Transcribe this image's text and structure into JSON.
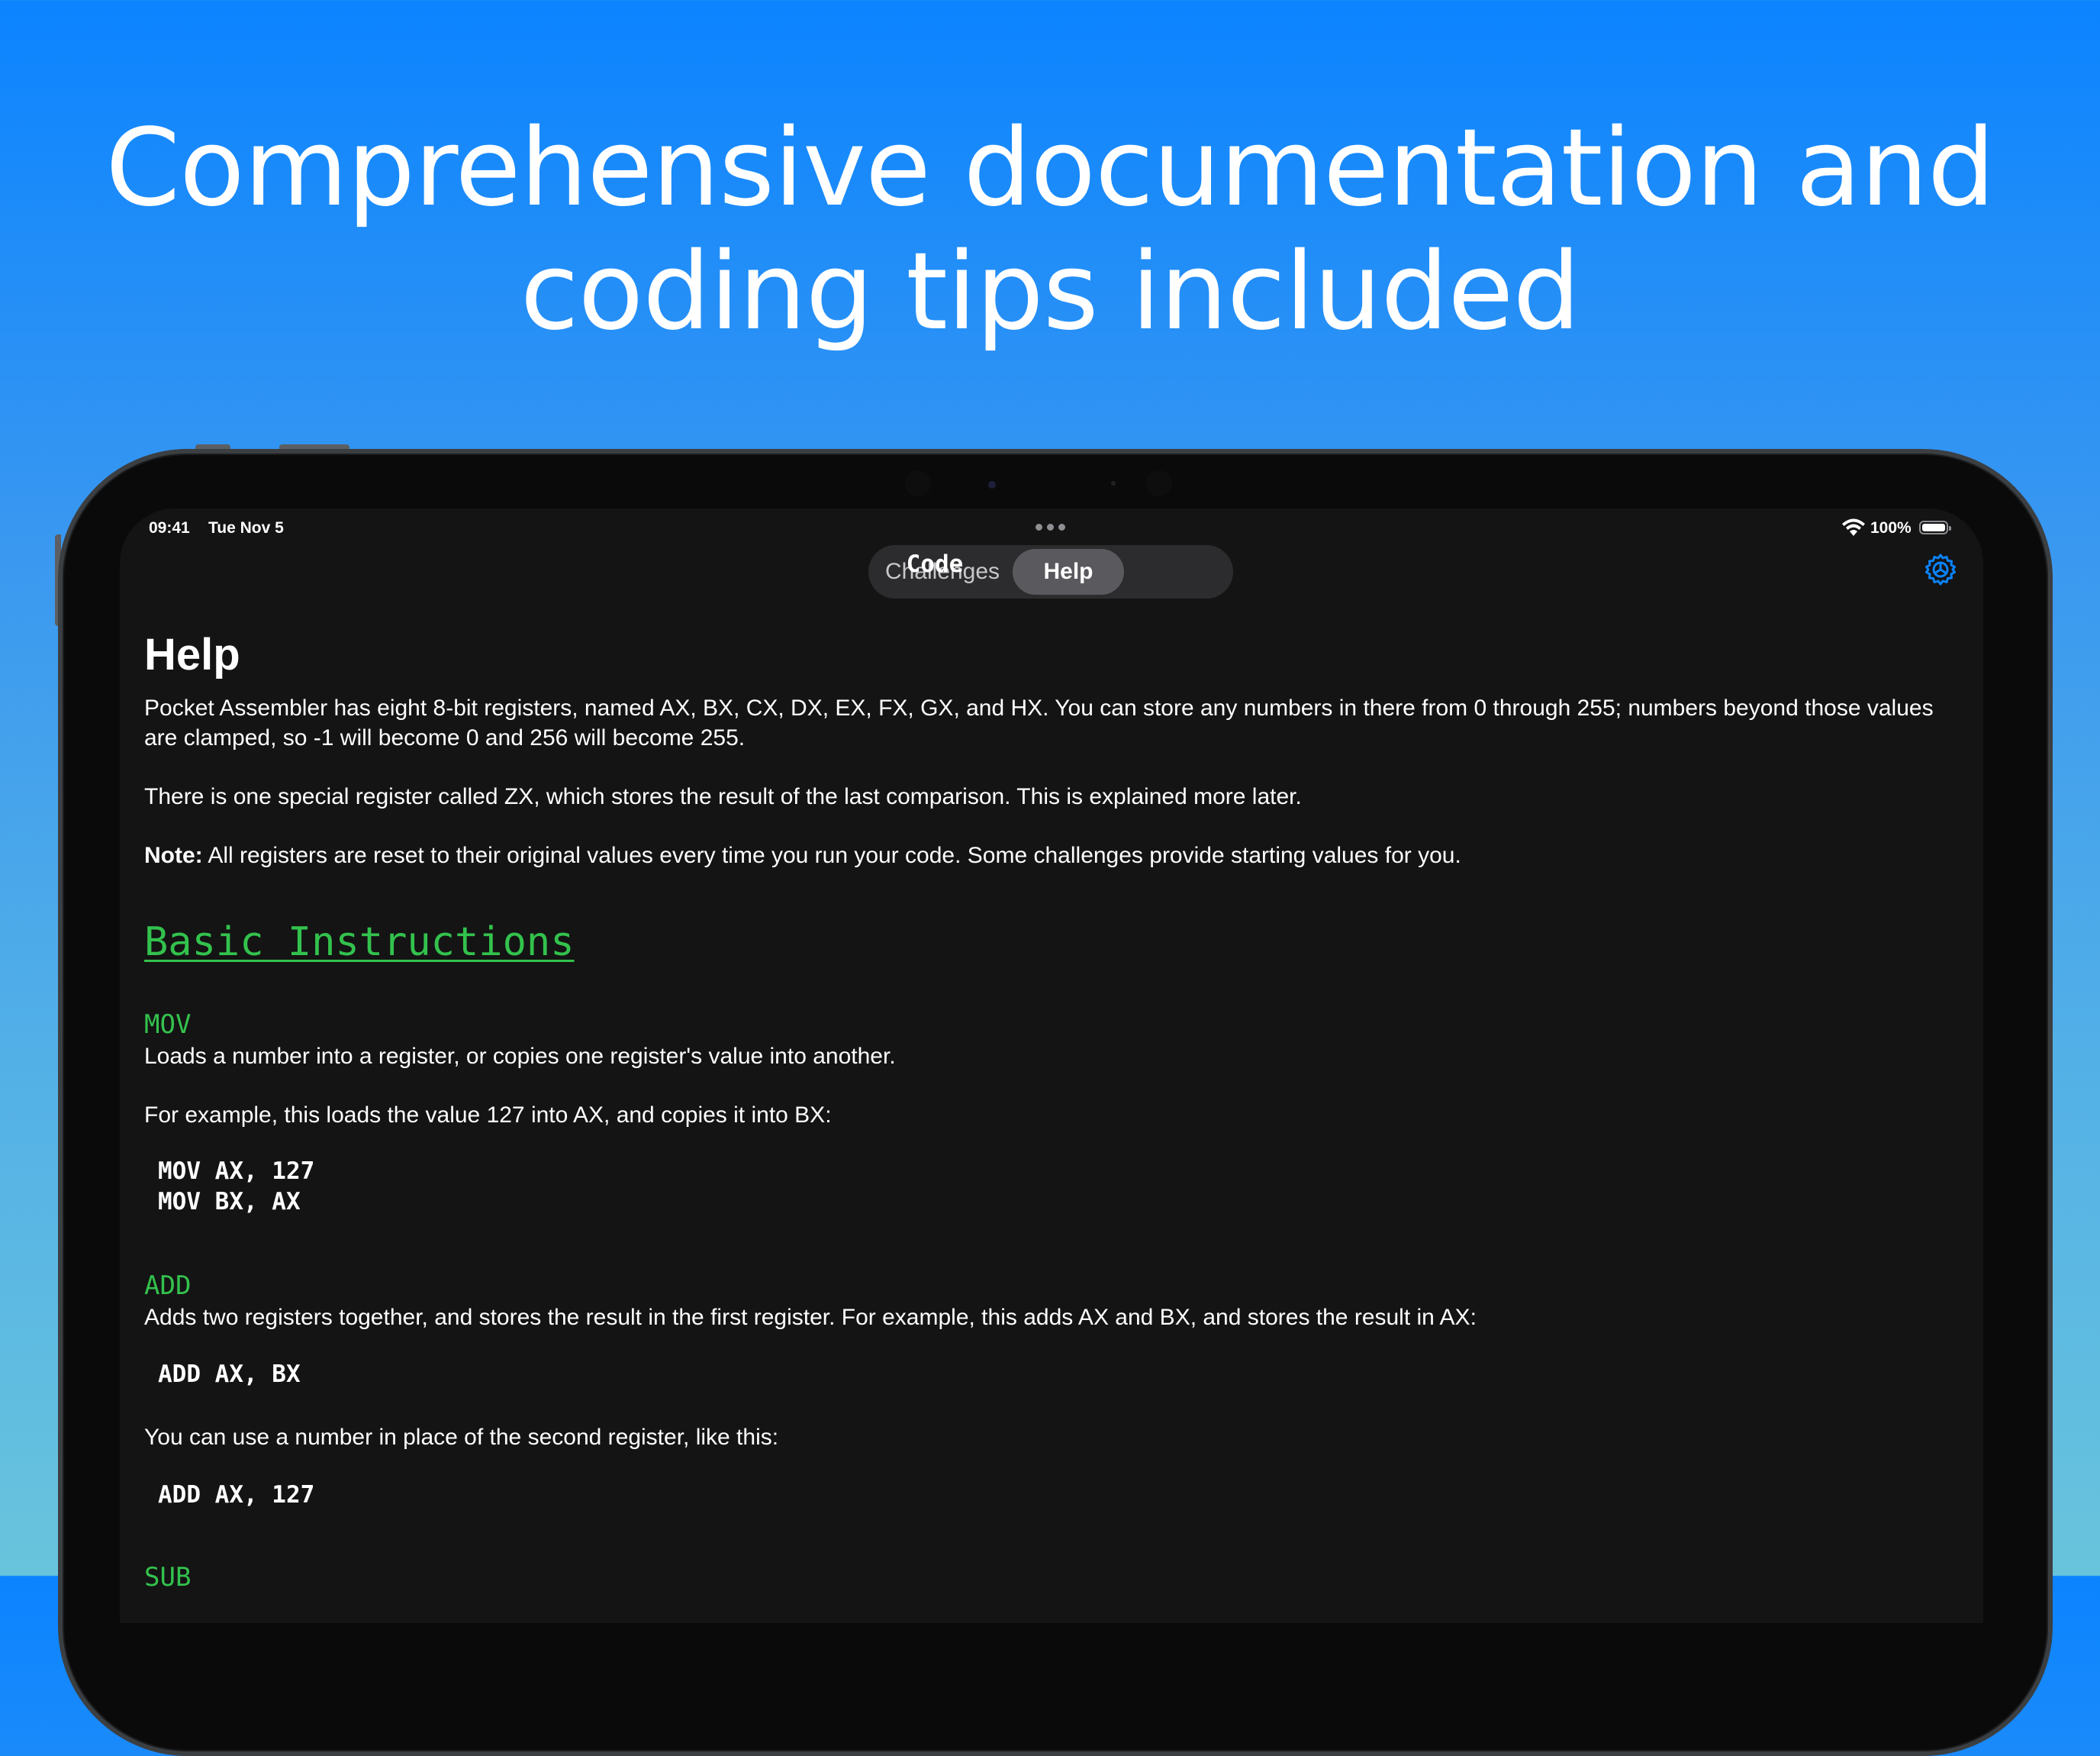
{
  "headline": {
    "line1": "Comprehensive documentation and",
    "line2": "coding tips included"
  },
  "status_bar": {
    "time": "09:41",
    "date": "Tue Nov 5",
    "battery": "100%"
  },
  "tabs": [
    {
      "label": "Code",
      "selected": false
    },
    {
      "label": "Challenges",
      "selected": false
    },
    {
      "label": "Help",
      "selected": true
    }
  ],
  "colors": {
    "accent_green": "#33c24d",
    "gear_blue": "#0a84ff",
    "background": "#141414"
  },
  "help": {
    "title": "Help",
    "intro_1a": "Pocket Assembler has eight 8-bit registers, named AX, BX, CX, DX, EX, FX, GX, and HX. You can store any numbers in there from 0 through 255; numbers beyond those values",
    "intro_1b": "are clamped, so -1 will become 0 and 256 will become 255.",
    "intro_2": "There is one special register called ZX, which stores the result of the last comparison. This is explained more later.",
    "note_label": "Note:",
    "note_text": " All registers are reset to their original values every time you run your code. Some challenges provide starting values for you.",
    "section_title": "Basic Instructions",
    "mov": {
      "name": "MOV",
      "desc": "Loads a number into a register, or copies one register's value into another.",
      "example_intro": "For example, this loads the value 127 into AX, and copies it into BX:",
      "code_1": "MOV AX, 127",
      "code_2": "MOV BX, AX"
    },
    "add": {
      "name": "ADD",
      "desc": "Adds two registers together, and stores the result in the first register. For example, this adds AX and BX, and stores the result in AX:",
      "code_1": "ADD AX, BX",
      "number_intro": "You can use a number in place of the second register, like this:",
      "code_2": "ADD AX, 127"
    },
    "sub": {
      "name": "SUB"
    }
  }
}
